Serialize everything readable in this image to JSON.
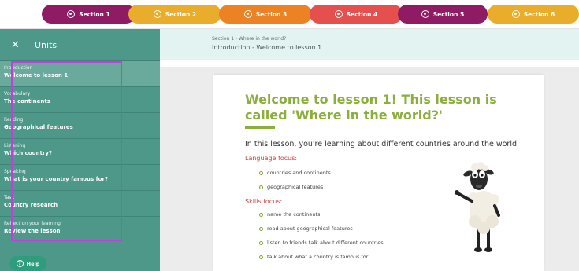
{
  "sections": [
    {
      "label": "Section 1",
      "color": "#8e1b64"
    },
    {
      "label": "Section 2",
      "color": "#e9ad2b"
    },
    {
      "label": "Section 3",
      "color": "#ec8224"
    },
    {
      "label": "Section 4",
      "color": "#e5504e"
    },
    {
      "label": "Section 5",
      "color": "#8e1b64"
    },
    {
      "label": "Section 6",
      "color": "#e9ad2b"
    }
  ],
  "sidebar": {
    "title": "Units",
    "items": [
      {
        "category": "Introduction",
        "title": "Welcome to lesson 1"
      },
      {
        "category": "Vocabulary",
        "title": "The continents"
      },
      {
        "category": "Reading",
        "title": "Geographical features"
      },
      {
        "category": "Listening",
        "title": "Which country?"
      },
      {
        "category": "Speaking",
        "title": "What is your country famous for?"
      },
      {
        "category": "Task",
        "title": "Country research"
      },
      {
        "category": "Reflect on your learning",
        "title": "Review the lesson"
      }
    ],
    "help_label": "Help"
  },
  "breadcrumb": {
    "path": "Section 1 - Where in the world?",
    "current": "Introduction - Welcome to lesson 1"
  },
  "content": {
    "title": "Welcome to lesson 1! This lesson is called 'Where in the world?'",
    "intro": "In this lesson, you're learning about different countries around the world.",
    "language_heading": "Language focus:",
    "language_items": [
      "countries and continents",
      "geographical features"
    ],
    "skills_heading": "Skills focus:",
    "skills_items": [
      "name the continents",
      "read about geographical features",
      "listen to friends talk about different countries",
      "talk about what a country is famous for"
    ]
  }
}
